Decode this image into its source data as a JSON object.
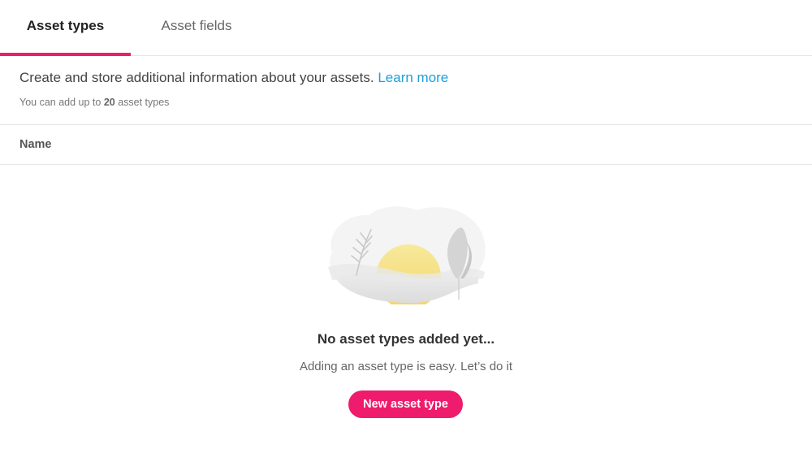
{
  "tabs": [
    {
      "label": "Asset types",
      "active": true
    },
    {
      "label": "Asset fields",
      "active": false
    }
  ],
  "intro": {
    "text": "Create and store additional information about your assets.",
    "link_label": "Learn more",
    "limit_prefix": "You can add up to",
    "limit_count": "20",
    "limit_suffix": "asset types"
  },
  "table": {
    "column_name": "Name"
  },
  "empty_state": {
    "illustration": "sunrise-landscape-illustration",
    "title": "No asset types added yet...",
    "subtitle": "Adding an asset type is easy. Let’s do it",
    "button_label": "New asset type"
  },
  "colors": {
    "accent": "#ef1b6c",
    "link": "#1c9fdc",
    "sun": "#f7e48c"
  }
}
